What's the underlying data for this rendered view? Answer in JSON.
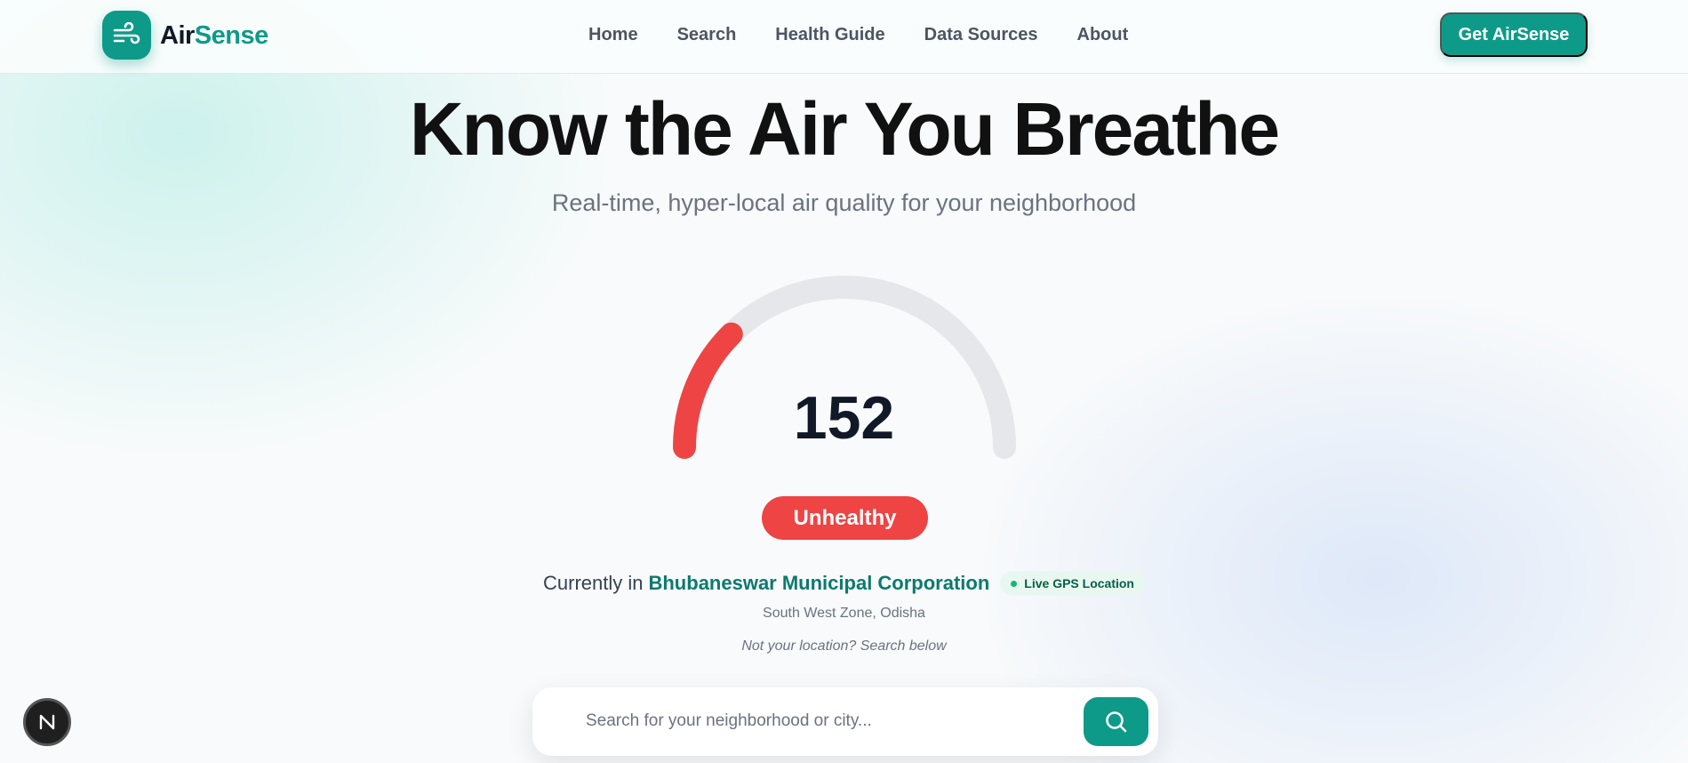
{
  "brand": {
    "name_part1": "Air",
    "name_part2": "Sense",
    "icon": "wind-icon",
    "accent_color": "#0e9a88"
  },
  "nav": {
    "links": [
      {
        "label": "Home"
      },
      {
        "label": "Search"
      },
      {
        "label": "Health Guide"
      },
      {
        "label": "Data Sources"
      },
      {
        "label": "About"
      }
    ],
    "cta_label": "Get AirSense"
  },
  "hero": {
    "title": "Know the Air You Breathe",
    "subtitle": "Real-time, hyper-local air quality for your neighborhood"
  },
  "aqi": {
    "value": "152",
    "gauge_fraction": 0.25,
    "status": "Unhealthy",
    "status_color": "#ef4444",
    "track_color": "#e5e7eb"
  },
  "location": {
    "prefix": "Currently in",
    "name": "Bhubaneswar Municipal Corporation",
    "live_badge": "Live GPS Location",
    "zone": "South West Zone, Odisha",
    "not_your_location": "Not your location? Search below"
  },
  "search": {
    "placeholder": "Search for your neighborhood or city...",
    "value": "",
    "button_icon": "search-icon"
  },
  "floating_badge": {
    "letter": "N"
  }
}
